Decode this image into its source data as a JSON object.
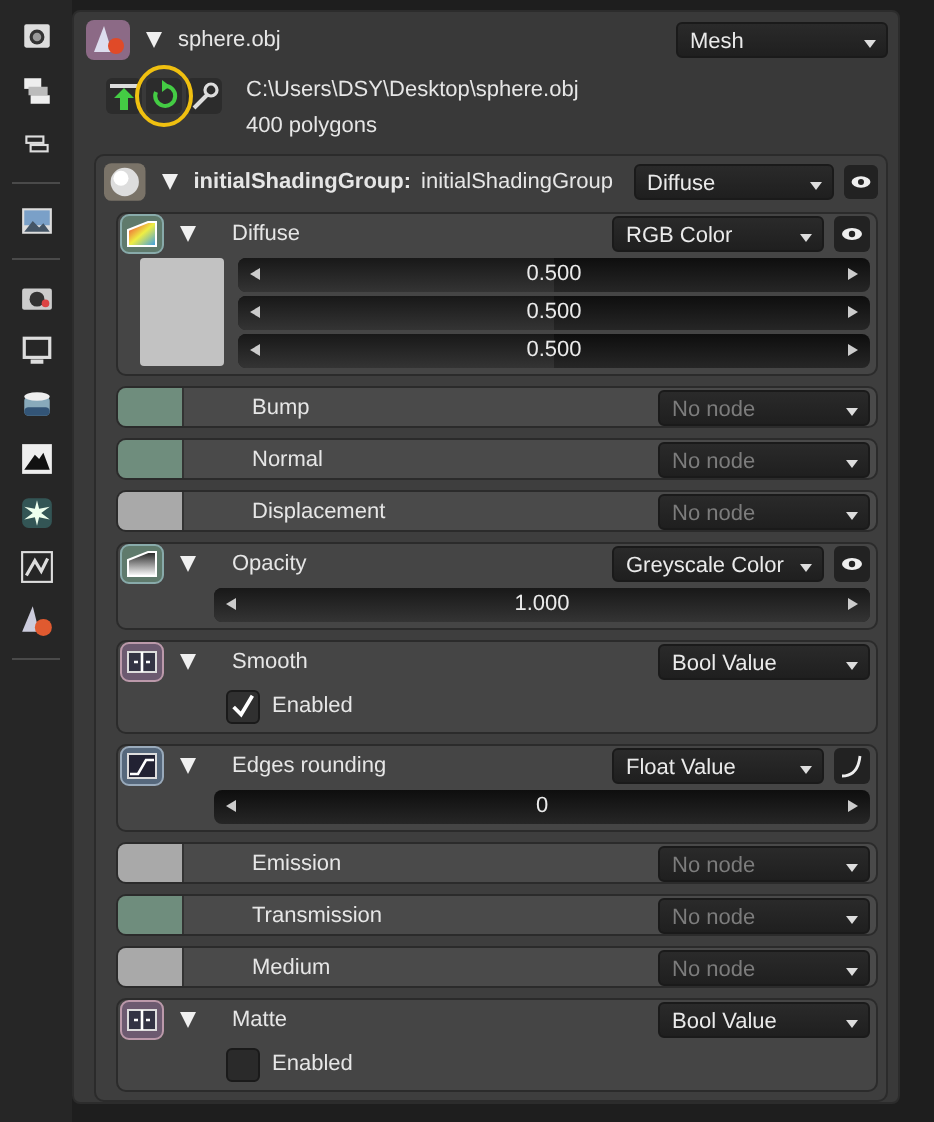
{
  "object": {
    "name": "sphere.obj",
    "expanded": true,
    "type": "Mesh",
    "path": "C:\\Users\\DSY\\Desktop\\sphere.obj",
    "info": "400 polygons"
  },
  "shading_group": {
    "label": "initialShadingGroup:",
    "name": "initialShadingGroup",
    "expanded": true,
    "type": "Diffuse"
  },
  "inputs": [
    {
      "kind": "color",
      "name": "Diffuse",
      "expanded": true,
      "type": "RGB Color",
      "color": "#c2c2c2",
      "values": [
        {
          "text": "0.500",
          "level": 0.5
        },
        {
          "text": "0.500",
          "level": 0.5
        },
        {
          "text": "0.500",
          "level": 0.5
        }
      ]
    },
    {
      "kind": "link",
      "name": "Bump",
      "color": "#6f8d7d",
      "value": "No node",
      "disabled": true
    },
    {
      "kind": "link",
      "name": "Normal",
      "color": "#6f8d7d",
      "value": "No node",
      "disabled": true
    },
    {
      "kind": "link",
      "name": "Displacement",
      "color": "#a9a9a9",
      "value": "No node",
      "disabled": true
    },
    {
      "kind": "greyscale",
      "name": "Opacity",
      "expanded": true,
      "type": "Greyscale Color",
      "values": [
        {
          "text": "1.000",
          "level": 1
        }
      ]
    },
    {
      "kind": "bool",
      "name": "Smooth",
      "expanded": true,
      "type": "Bool Value",
      "option": "Enabled",
      "checked": true
    },
    {
      "kind": "float",
      "name": "Edges rounding",
      "expanded": true,
      "type": "Float Value",
      "values": [
        {
          "text": "0",
          "level": 0
        }
      ]
    },
    {
      "kind": "link",
      "name": "Emission",
      "color": "#a9a9a9",
      "value": "No node",
      "disabled": true
    },
    {
      "kind": "link",
      "name": "Transmission",
      "color": "#6f8d7d",
      "value": "No node",
      "disabled": true
    },
    {
      "kind": "link",
      "name": "Medium",
      "color": "#a9a9a9",
      "value": "No node",
      "disabled": true
    },
    {
      "kind": "bool",
      "name": "Matte",
      "expanded": true,
      "type": "Bool Value",
      "option": "Enabled",
      "checked": false
    }
  ]
}
